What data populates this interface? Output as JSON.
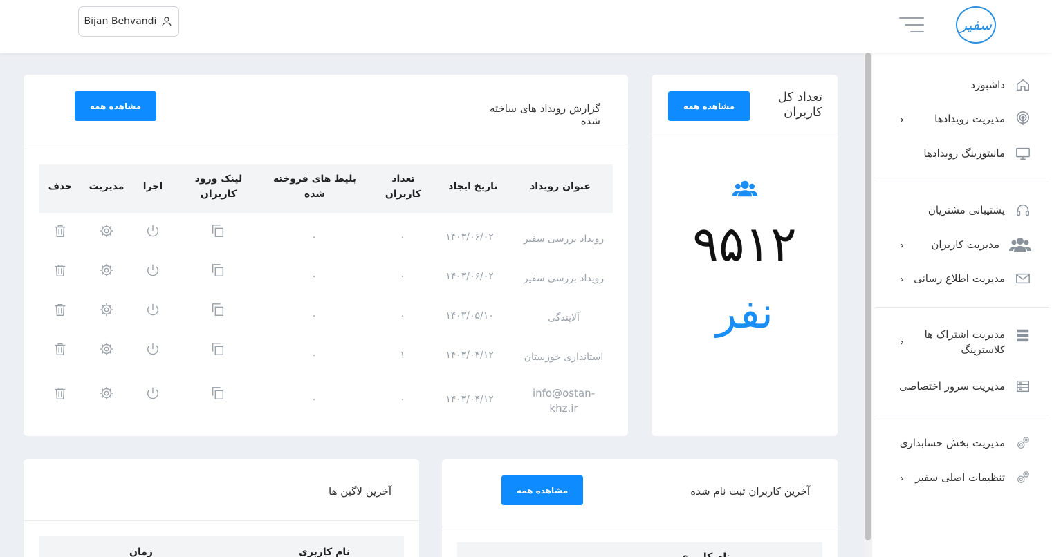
{
  "header": {
    "user_name": "Bijan Behvandi",
    "logo_text": "سفیر"
  },
  "sidebar": {
    "items": [
      {
        "label": "داشبورد",
        "icon": "home-icon"
      },
      {
        "label": "مدیریت رویدادها",
        "icon": "podcast-icon"
      },
      {
        "label": "مانیتورینگ رویدادها",
        "icon": "monitor-icon"
      },
      {
        "label": "پشتیبانی مشتریان",
        "icon": "headset-icon"
      },
      {
        "label": "مدیریت کاربران",
        "icon": "users-icon"
      },
      {
        "label": "مدیریت اطلاع رسانی",
        "icon": "envelope-icon"
      },
      {
        "label": "مدیریت اشتراک ها کلاسترینگ",
        "icon": "server-icon"
      },
      {
        "label": "مدیریت سرور اختصاصی",
        "icon": "server-rack-icon"
      },
      {
        "label": "مدیریت بخش حسابداری",
        "icon": "cogs-icon"
      },
      {
        "label": "تنظیمات اصلی سفیر",
        "icon": "cogs-icon"
      }
    ]
  },
  "users_card": {
    "title": "تعداد کل کاربران",
    "button": "مشاهده همه",
    "count": "۹۵۱۲",
    "unit": "نفر"
  },
  "events_card": {
    "title": "گزارش رویداد های ساخته شده",
    "button": "مشاهده همه",
    "columns": [
      "عنوان رویداد",
      "تاریخ ایجاد",
      "تعداد کاربران",
      "بلیط های فروخته شده",
      "لینک ورود کاربران",
      "اجرا",
      "مدیریت",
      "حذف"
    ],
    "rows": [
      {
        "title": "رویداد بررسی سفیر",
        "date": "۱۴۰۳/۰۶/۰۲",
        "users": "۰",
        "tickets": "۰"
      },
      {
        "title": "رویداد بررسی سفیر",
        "date": "۱۴۰۳/۰۶/۰۲",
        "users": "۰",
        "tickets": "۰"
      },
      {
        "title": "آلایندگی",
        "date": "۱۴۰۳/۰۵/۱۰",
        "users": "۰",
        "tickets": "۰"
      },
      {
        "title": "استانداری خوزستان",
        "date": "۱۴۰۳/۰۴/۱۲",
        "users": "۱",
        "tickets": "۰"
      },
      {
        "title": "info@ostan-khz.ir",
        "date": "۱۴۰۳/۰۴/۱۲",
        "users": "۰",
        "tickets": "۰"
      }
    ]
  },
  "logins_card": {
    "title": "آخرین لاگین ها",
    "columns": [
      "نام کاربری",
      "زمان"
    ]
  },
  "registered_card": {
    "title": "آخرین کاربران ثبت نام شده",
    "button": "مشاهده همه",
    "columns": [
      "نام کاربری"
    ]
  },
  "colors": {
    "accent": "#0d8bff",
    "brand": "#2b8fde"
  }
}
